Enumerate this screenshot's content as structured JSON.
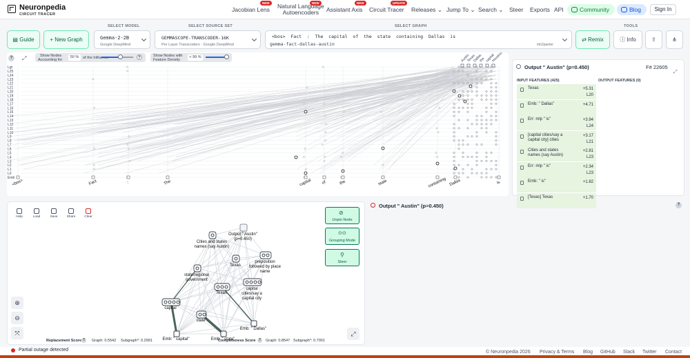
{
  "brand": {
    "name": "Neuronpedia",
    "sub": "CIRCUIT TRACER"
  },
  "nav": {
    "jacobian": "Jacobian Lens",
    "nla_line1": "Natural Language",
    "nla_line2": "Autoencoders",
    "assistant": "Assistant Axis",
    "circuit": "Circuit Tracer",
    "releases": "Releases",
    "jump": "Jump To",
    "search": "Search",
    "steer": "Steer",
    "exports": "Exports",
    "api": "API",
    "community": "Community",
    "blog": "Blog",
    "signin": "Sign In",
    "badge_new": "NEW",
    "badge_update": "UPDATE"
  },
  "toolbar": {
    "guide": "Guide",
    "new_graph": "New Graph",
    "model_label": "SELECT MODEL",
    "model_value": "Gemma-2-2B",
    "model_sub": "Google DeepMind",
    "source_label": "SELECT SOURCE SET",
    "source_value": "GEMMASCOPE-TRANSCODER-16K",
    "source_sub": "Per Layer Transcoders · Google DeepMind",
    "graph_label": "SELECT GRAPH",
    "graph_tokens": "<bos>  Fact  :  The  capital  of  the  state  containing  Dallas  is",
    "graph_slug": "gemma-fact-dallas-austin",
    "graph_owner": "mh2panter",
    "tools_label": "TOOLS",
    "remix": "Remix",
    "info": "Info"
  },
  "graph_controls": {
    "show_nodes_line1": "Show Nodes",
    "show_nodes_line2": "Accounting for",
    "influence_value": "50",
    "influence_unit": "%",
    "influence_suffix": "of the Influence",
    "density_line1": "Show Nodes with",
    "density_line2": "Feature Density",
    "density_value": "< 99",
    "density_unit": "%"
  },
  "layers": [
    "Lgt",
    "L25",
    "L24",
    "L23",
    "L22",
    "L21",
    "L20",
    "L19",
    "L18",
    "L17",
    "L16",
    "L15",
    "L14",
    "L13",
    "L12",
    "L11",
    "L10",
    "L9",
    "L8",
    "L7",
    "L6",
    "L5",
    "L4",
    "L3",
    "L2",
    "L1",
    "L0",
    "Emb"
  ],
  "tokens": [
    "<bos>",
    "Fact",
    ":",
    "The",
    "capital",
    "of",
    "the",
    "state",
    "containing",
    "Dallas",
    "is"
  ],
  "output_labels": [
    "Austin",
    "Texas",
    "Dallas",
    "the",
    "capital",
    "Houston"
  ],
  "features_panel": {
    "title": "Output \" Austin\" (p=0.450)",
    "feature_id": "F# 22605",
    "input_header": "INPUT FEATURES (425)",
    "output_header": "OUTPUT FEATURES (0)",
    "inputs": [
      {
        "label": "Texas",
        "value": "+5.31",
        "layer": "L20"
      },
      {
        "label": "Emb: \" Dallas\"",
        "value": "+4.71",
        "layer": ""
      },
      {
        "label": "Err: mlp \" is\"",
        "value": "+3.94",
        "layer": "L24"
      },
      {
        "label": "[capital cities/say a capital city] cities",
        "value": "+3.17",
        "layer": "L21"
      },
      {
        "label": "Cities and states names (say Austin)",
        "value": "+2.81",
        "layer": "L23"
      },
      {
        "label": "Err: mlp \" is\"",
        "value": "+2.34",
        "layer": "L23"
      },
      {
        "label": "Emb: \" is\"",
        "value": "+1.82",
        "layer": ""
      },
      {
        "label": "[Texas] Texas",
        "value": "+1.70",
        "layer": ""
      }
    ]
  },
  "subgraph": {
    "tools": [
      "Help",
      "Load",
      "Save",
      "Share",
      "Clear"
    ],
    "unpin": "Unpin Node",
    "grouping": "Grouping Mode",
    "steer": "Steer",
    "nodes": {
      "output": "Output \" Austin\" (p=0.450)",
      "cities_states": "Cities and states names (say Austin)",
      "texas_top": "Texas",
      "preposition": "preposition followed by place name",
      "state_regional": "state/regional government",
      "texas_mid": "Texas",
      "capital_cities": "capital cities/say a capital city",
      "capital": "capital",
      "state": "state",
      "emb_dallas": "Emb: \" Dallas\"",
      "emb_capital": "Emb: \" capital\"",
      "emb_state": "Emb: \" state\""
    },
    "replacement_label": "Replacement Score",
    "graph_score_1": "Graph: 0.5542",
    "subgraph_score_1": "Subgraph*: 0.2991",
    "completeness_label": "Completeness Score",
    "graph_score_2": "Graph: 0.8547",
    "subgraph_score_2": "Subgraph*: 0.7001"
  },
  "lower_right_title": "Output \" Austin\" (p=0.450)",
  "status": "Partial outage detected",
  "footer": {
    "copyright": "© Neuronpedia 2026",
    "privacy": "Privacy & Terms",
    "blog": "Blog",
    "github": "GitHub",
    "slack": "Slack",
    "twitter": "Twitter",
    "contact": "Contact"
  },
  "colors": {
    "accent_green": "#10b981",
    "status_red": "#dc2626",
    "footer_bar": "#c2410c"
  }
}
